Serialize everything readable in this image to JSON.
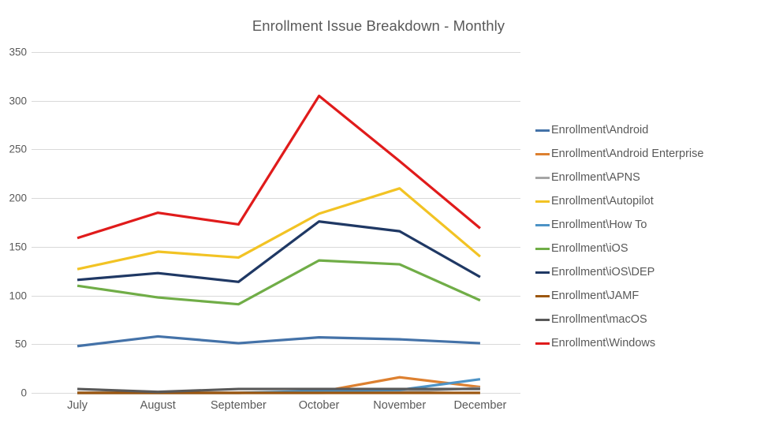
{
  "chart_data": {
    "type": "line",
    "title": "Enrollment Issue Breakdown - Monthly",
    "xlabel": "",
    "ylabel": "",
    "categories": [
      "July",
      "August",
      "September",
      "October",
      "November",
      "December"
    ],
    "ylim": [
      0,
      350
    ],
    "ytick_step": 50,
    "yticks": [
      0,
      50,
      100,
      150,
      200,
      250,
      300,
      350
    ],
    "grid": true,
    "legend_position": "right",
    "series": [
      {
        "name": "Enrollment\\Android",
        "color": "#4472a8",
        "values": [
          48,
          58,
          51,
          57,
          55,
          51
        ]
      },
      {
        "name": "Enrollment\\Android Enterprise",
        "color": "#dd8030",
        "values": [
          0,
          0,
          0,
          1,
          16,
          6
        ]
      },
      {
        "name": "Enrollment\\APNS",
        "color": "#a5a5a5",
        "values": [
          0,
          0,
          0,
          0,
          1,
          5
        ]
      },
      {
        "name": "Enrollment\\Autopilot",
        "color": "#f2c324",
        "values": [
          127,
          145,
          139,
          184,
          210,
          140
        ]
      },
      {
        "name": "Enrollment\\How To",
        "color": "#4d93c6",
        "values": [
          0,
          0,
          0,
          2,
          3,
          14
        ]
      },
      {
        "name": "Enrollment\\iOS",
        "color": "#7aa košice",
        "values": [
          110,
          98,
          91,
          136,
          132,
          95
        ]
      },
      {
        "name": "Enrollment\\iOS\\DEP",
        "color": "#1f3864",
        "values": [
          116,
          123,
          114,
          176,
          166,
          119
        ]
      },
      {
        "name": "Enrollment\\JAMF",
        "color": "#9c5710",
        "values": [
          0,
          0,
          0,
          0,
          0,
          0
        ]
      },
      {
        "name": "Enrollment\\macOS",
        "color": "#595959",
        "values": [
          4,
          1,
          4,
          4,
          4,
          4
        ]
      },
      {
        "name": "Enrollment\\Windows",
        "color": "#e01b1b",
        "values": [
          159,
          185,
          173,
          305,
          238,
          169
        ]
      }
    ]
  },
  "legend": {
    "items": [
      {
        "label": "Enrollment\\Android",
        "color": "#4472a8"
      },
      {
        "label": "Enrollment\\Android Enterprise",
        "color": "#dd8030"
      },
      {
        "label": "Enrollment\\APNS",
        "color": "#a5a5a5"
      },
      {
        "label": "Enrollment\\Autopilot",
        "color": "#f2c324"
      },
      {
        "label": "Enrollment\\How To",
        "color": "#4d93c6"
      },
      {
        "label": "Enrollment\\iOS",
        "color": "#70ad47"
      },
      {
        "label": "Enrollment\\iOS\\DEP",
        "color": "#1f3864"
      },
      {
        "label": "Enrollment\\JAMF",
        "color": "#9c5710"
      },
      {
        "label": "Enrollment\\macOS",
        "color": "#595959"
      },
      {
        "label": "Enrollment\\Windows",
        "color": "#e01b1b"
      }
    ]
  }
}
